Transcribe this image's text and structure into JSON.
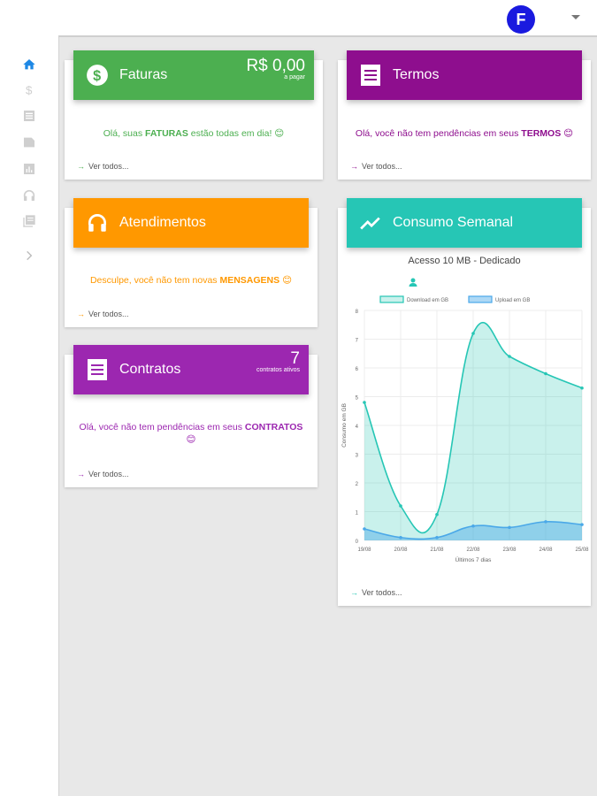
{
  "header": {
    "avatar_initial": "F"
  },
  "sidebar": {
    "items": [
      {
        "icon": "home-icon",
        "active": true
      },
      {
        "icon": "dollar-icon"
      },
      {
        "icon": "document-icon"
      },
      {
        "icon": "file-icon"
      },
      {
        "icon": "bar-chart-icon"
      },
      {
        "icon": "headset-icon"
      },
      {
        "icon": "library-icon"
      },
      {
        "icon": "chevron-right-icon"
      }
    ]
  },
  "cards": {
    "faturas": {
      "title": "Faturas",
      "amount": "R$ 0,00",
      "amount_sub": "a pagar",
      "msg_prefix": "Olá, suas ",
      "msg_strong": "FATURAS",
      "msg_suffix": " estão todas em dia! 😊",
      "link": "Ver todos...",
      "color": "#4caf50"
    },
    "termos": {
      "title": "Termos",
      "msg_prefix": "Olá, você não tem pendências em seus ",
      "msg_strong": "TERMOS",
      "msg_suffix": " 😊",
      "link": "Ver todos...",
      "color": "#8e0e8e"
    },
    "atendimentos": {
      "title": "Atendimentos",
      "msg_prefix": "Desculpe, você não tem novas ",
      "msg_strong": "MENSAGENS",
      "msg_suffix": " 😊",
      "link": "Ver todos...",
      "color": "#ff9800"
    },
    "contratos": {
      "title": "Contratos",
      "count": "7",
      "count_sub": "contratos ativos",
      "msg_prefix": "Olá, você não tem pendências em seus ",
      "msg_strong": "CONTRATOS",
      "msg_suffix": "😊",
      "link": "Ver todos...",
      "color": "#9c27b0"
    },
    "consumo": {
      "title": "Consumo Semanal",
      "subtitle": "Acesso 10 MB - Dedicado",
      "link": "Ver todos...",
      "color": "#26c6b5"
    }
  },
  "chart_data": {
    "type": "area",
    "x": [
      "19/08",
      "20/08",
      "21/08",
      "22/08",
      "23/08",
      "24/08",
      "25/08"
    ],
    "series": [
      {
        "name": "Download em GB",
        "values": [
          4.8,
          1.2,
          0.9,
          7.2,
          6.4,
          5.8,
          5.3
        ],
        "color": "#26c6b5"
      },
      {
        "name": "Upload em GB",
        "values": [
          0.4,
          0.1,
          0.1,
          0.5,
          0.45,
          0.65,
          0.55
        ],
        "color": "#4aa8e8"
      }
    ],
    "ylabel": "Consumo em GB",
    "xlabel": "Últimos 7 dias",
    "ylim": [
      0,
      8
    ],
    "yticks": [
      "0",
      "1",
      "2",
      "3",
      "4",
      "5",
      "6",
      "7",
      "8"
    ],
    "legend": "top"
  }
}
